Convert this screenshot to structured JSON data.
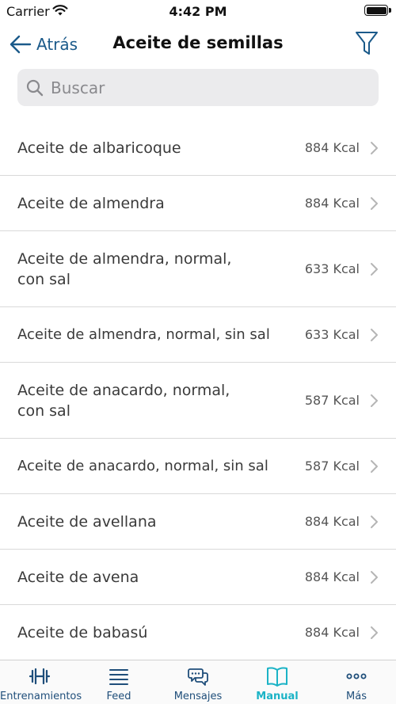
{
  "status_bar": {
    "carrier": "Carrier",
    "time": "4:42 PM"
  },
  "nav": {
    "back_label": "Atrás",
    "title": "Aceite de semillas"
  },
  "search": {
    "placeholder": "Buscar",
    "value": ""
  },
  "items": [
    {
      "name": "Aceite de albaricoque",
      "kcal": "884 Kcal"
    },
    {
      "name": "Aceite de almendra",
      "kcal": "884 Kcal"
    },
    {
      "name": "Aceite de almendra, normal, con sal",
      "kcal": "633 Kcal"
    },
    {
      "name": "Aceite de almendra, normal, sin sal",
      "kcal": "633 Kcal"
    },
    {
      "name": "Aceite de anacardo, normal, con sal",
      "kcal": "587 Kcal"
    },
    {
      "name": "Aceite de anacardo, normal, sin sal",
      "kcal": "587 Kcal"
    },
    {
      "name": "Aceite de avellana",
      "kcal": "884 Kcal"
    },
    {
      "name": "Aceite de avena",
      "kcal": "884 Kcal"
    },
    {
      "name": "Aceite de babasú",
      "kcal": "884 Kcal"
    }
  ],
  "tabs": [
    {
      "label": "Entrenamientos",
      "icon": "dumbbell-icon"
    },
    {
      "label": "Feed",
      "icon": "menu-lines-icon"
    },
    {
      "label": "Mensajes",
      "icon": "chat-bubbles-icon"
    },
    {
      "label": "Manual",
      "icon": "book-icon",
      "active": true
    },
    {
      "label": "Más",
      "icon": "more-dots-icon"
    }
  ],
  "colors": {
    "accent_blue": "#1b5a8a",
    "active_tab": "#1bb3c6"
  }
}
